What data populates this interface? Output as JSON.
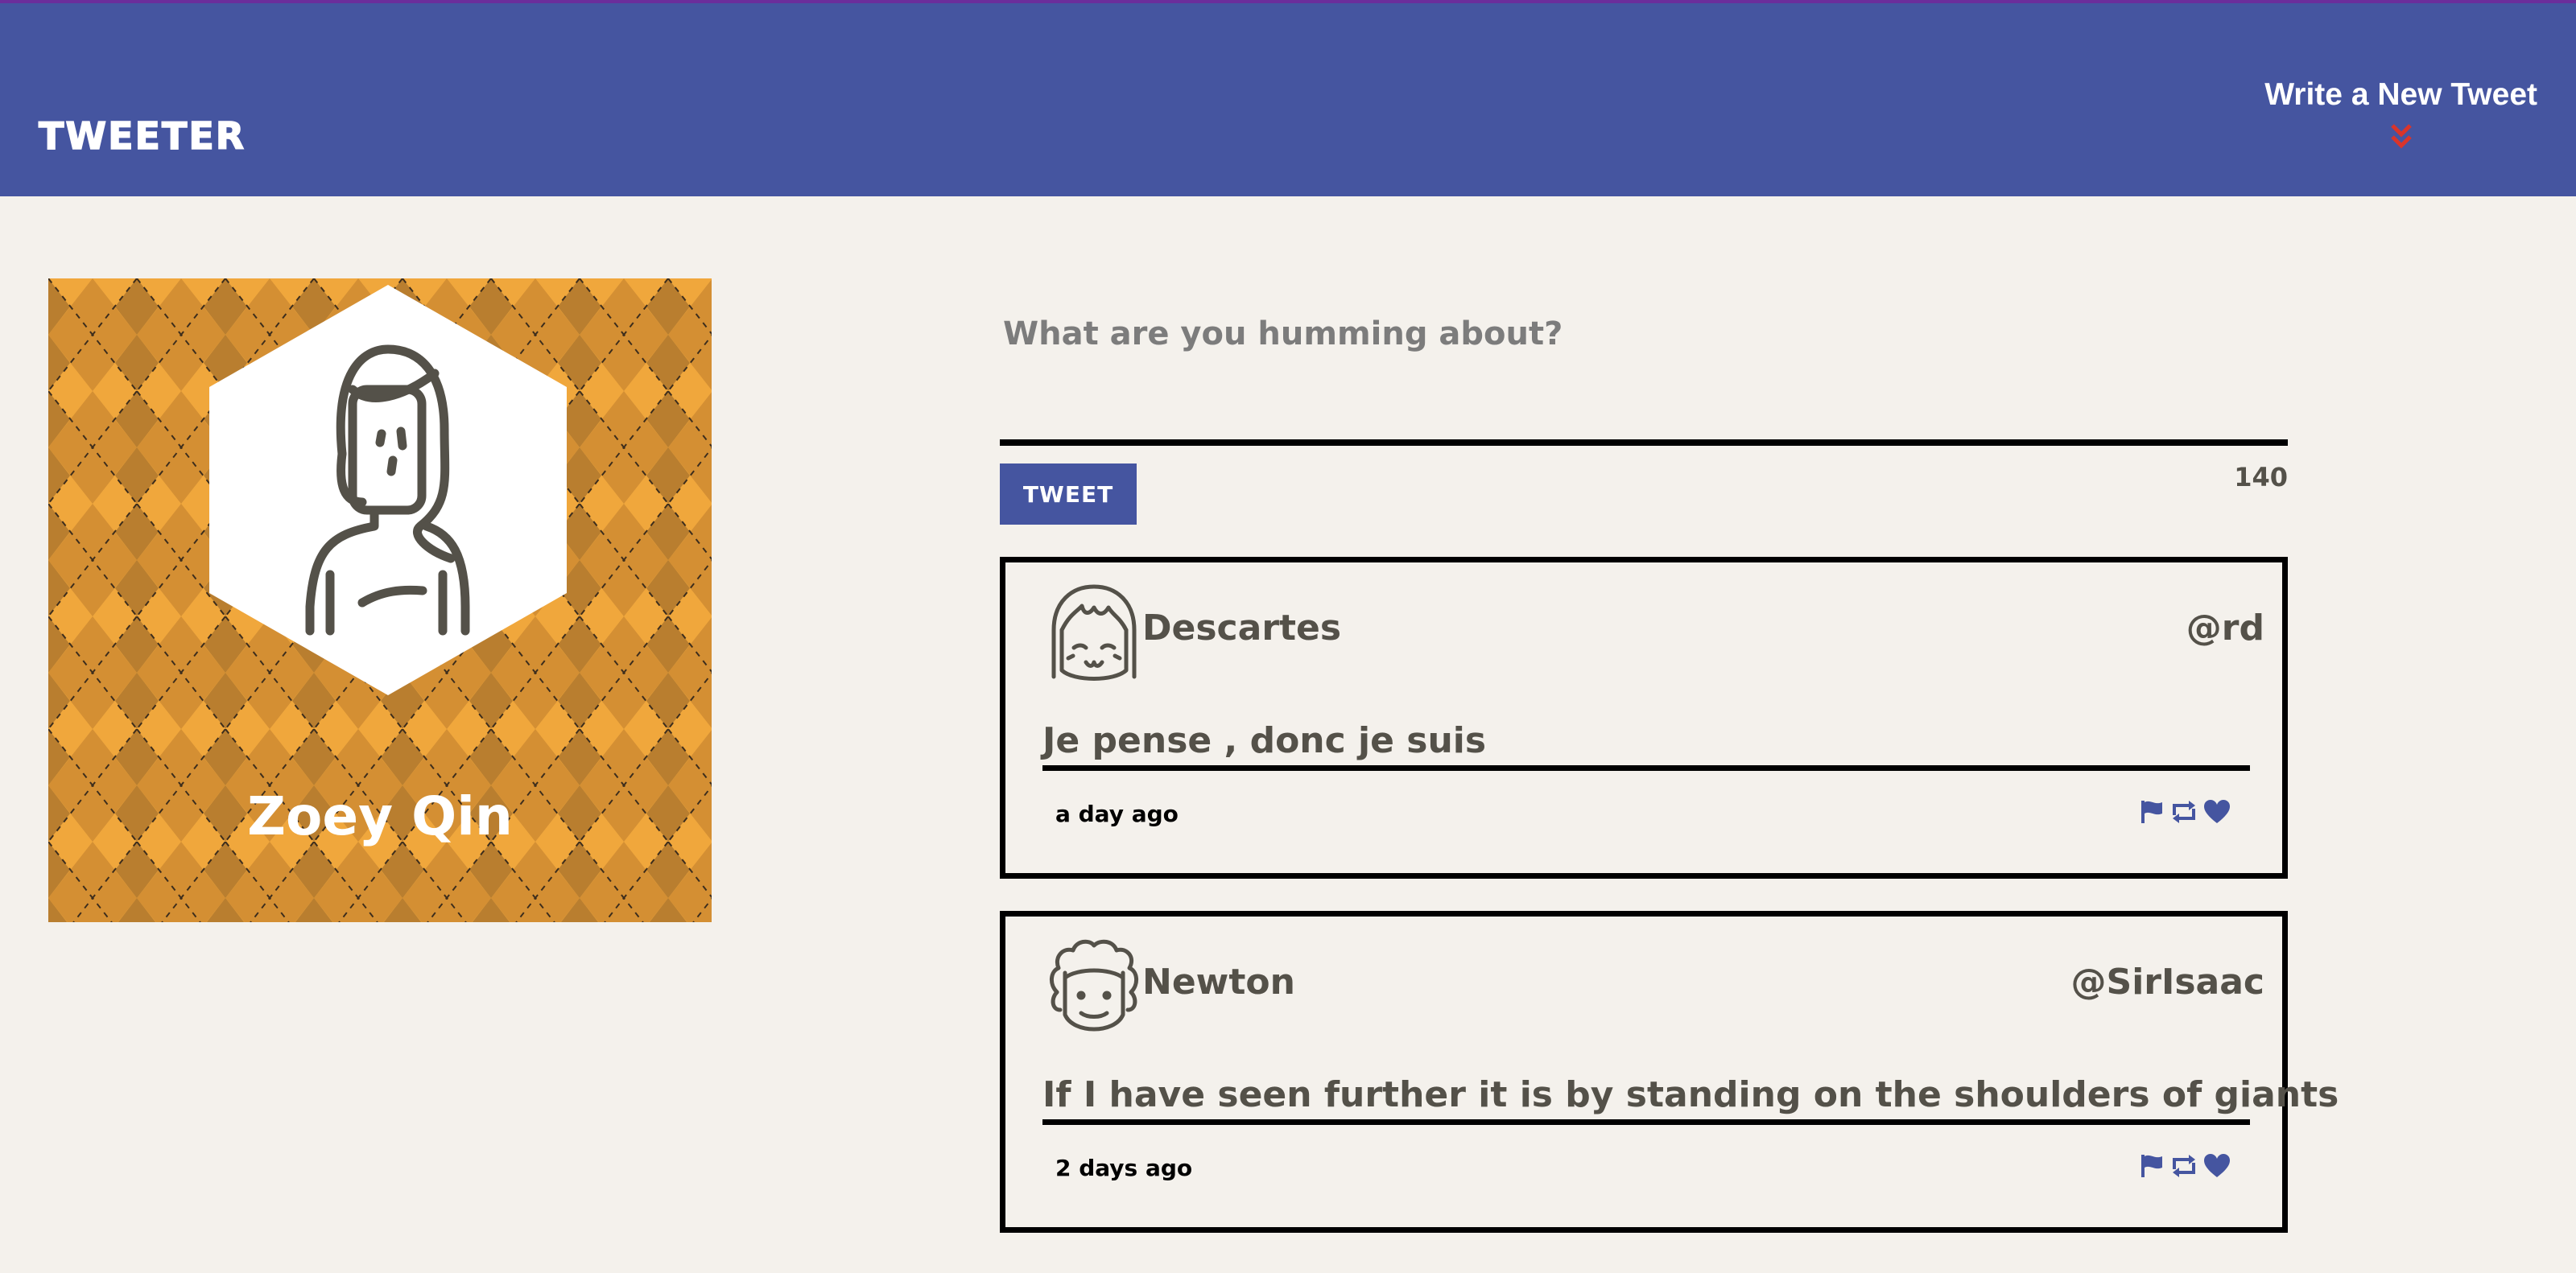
{
  "app": {
    "brand": "TWEETER",
    "compose_toggle_label": "Write a New Tweet",
    "accent_color": "#4555a0",
    "chevron_color": "#d9342b",
    "page_background": "#f4f1ec"
  },
  "profile": {
    "name": "Zoey Qin",
    "background_pattern": "orange argyle",
    "avatar_icon": "woman-portrait-icon"
  },
  "compose": {
    "placeholder": "What are you humming about?",
    "button_label": "TWEET",
    "char_counter": "140"
  },
  "tweets": [
    {
      "name": "Descartes",
      "handle": "@rd",
      "content": "Je pense , donc je suis",
      "time": "a day ago",
      "avatar_icon": "girl-bangs-avatar-icon",
      "actions": [
        "flag-icon",
        "retweet-icon",
        "heart-icon"
      ]
    },
    {
      "name": "Newton",
      "handle": "@SirIsaac",
      "content": "If I have seen further it is by standing on the shoulders of giants",
      "time": "2 days ago",
      "avatar_icon": "curly-hair-avatar-icon",
      "actions": [
        "flag-icon",
        "retweet-icon",
        "heart-icon"
      ]
    }
  ]
}
